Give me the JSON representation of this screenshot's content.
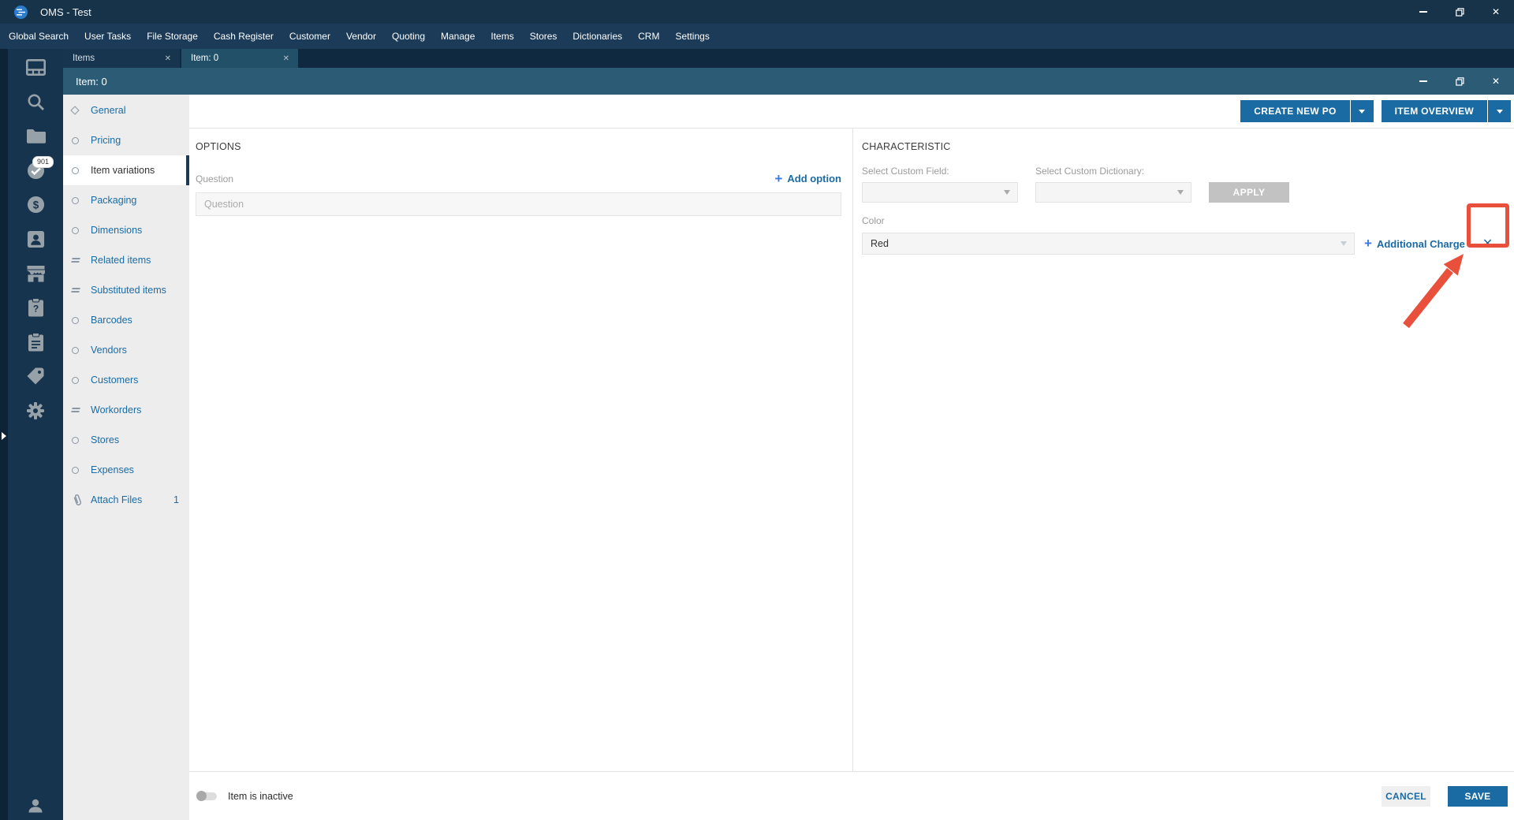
{
  "window": {
    "title": "OMS - Test"
  },
  "menu": {
    "items": [
      "Global Search",
      "User Tasks",
      "File Storage",
      "Cash Register",
      "Customer",
      "Vendor",
      "Quoting",
      "Manage",
      "Items",
      "Stores",
      "Dictionaries",
      "CRM",
      "Settings"
    ]
  },
  "tabs": [
    {
      "label": "Items",
      "active": false
    },
    {
      "label": "Item: 0",
      "active": true
    }
  ],
  "subwindow": {
    "title": "Item: 0"
  },
  "actions": {
    "create_new_po": "CREATE NEW PO",
    "item_overview": "ITEM OVERVIEW"
  },
  "sidebar": {
    "items": [
      {
        "icon": "dashboard-icon"
      },
      {
        "icon": "search-icon"
      },
      {
        "icon": "folders-icon"
      },
      {
        "icon": "tasks-check-icon",
        "badge": "901"
      },
      {
        "icon": "money-icon"
      },
      {
        "icon": "contacts-icon"
      },
      {
        "icon": "store-icon"
      },
      {
        "icon": "inquiry-clipboard-icon"
      },
      {
        "icon": "orders-clipboard-icon"
      },
      {
        "icon": "tags-icon"
      },
      {
        "icon": "settings-gear-icon"
      }
    ],
    "bottom_icon": "user-icon"
  },
  "nav": {
    "items": [
      {
        "label": "General",
        "icon": "diamond-icon",
        "selected": false
      },
      {
        "label": "Pricing",
        "icon": "circle-icon",
        "selected": false
      },
      {
        "label": "Item variations",
        "icon": "circle-icon",
        "selected": true
      },
      {
        "label": "Packaging",
        "icon": "circle-icon",
        "selected": false
      },
      {
        "label": "Dimensions",
        "icon": "circle-icon",
        "selected": false
      },
      {
        "label": "Related items",
        "icon": "equals-icon",
        "selected": false
      },
      {
        "label": "Substituted items",
        "icon": "equals-icon",
        "selected": false
      },
      {
        "label": "Barcodes",
        "icon": "circle-icon",
        "selected": false
      },
      {
        "label": "Vendors",
        "icon": "circle-icon",
        "selected": false
      },
      {
        "label": "Customers",
        "icon": "circle-icon",
        "selected": false
      },
      {
        "label": "Workorders",
        "icon": "equals-icon",
        "selected": false
      },
      {
        "label": "Stores",
        "icon": "circle-icon",
        "selected": false
      },
      {
        "label": "Expenses",
        "icon": "circle-icon",
        "selected": false
      },
      {
        "label": "Attach Files",
        "icon": "paperclip-icon",
        "selected": false,
        "badge": "1"
      }
    ]
  },
  "options": {
    "heading": "OPTIONS",
    "question_label": "Question",
    "add_option": "Add option",
    "input_placeholder": "Question",
    "input_value": ""
  },
  "characteristic": {
    "heading": "CHARACTERISTIC",
    "custom_field_label": "Select Custom Field:",
    "custom_dictionary_label": "Select Custom Dictionary:",
    "apply": "APPLY",
    "color_label": "Color",
    "color_value": "Red",
    "additional_charge": "Additional Charge"
  },
  "footer": {
    "toggle_label": "Item is inactive",
    "cancel": "CANCEL",
    "save": "SAVE"
  },
  "colors": {
    "accent_blue": "#1A6BA4",
    "annotation_red": "#E8503C",
    "titlebar": "#17334A",
    "subheader": "#2C5B76"
  }
}
